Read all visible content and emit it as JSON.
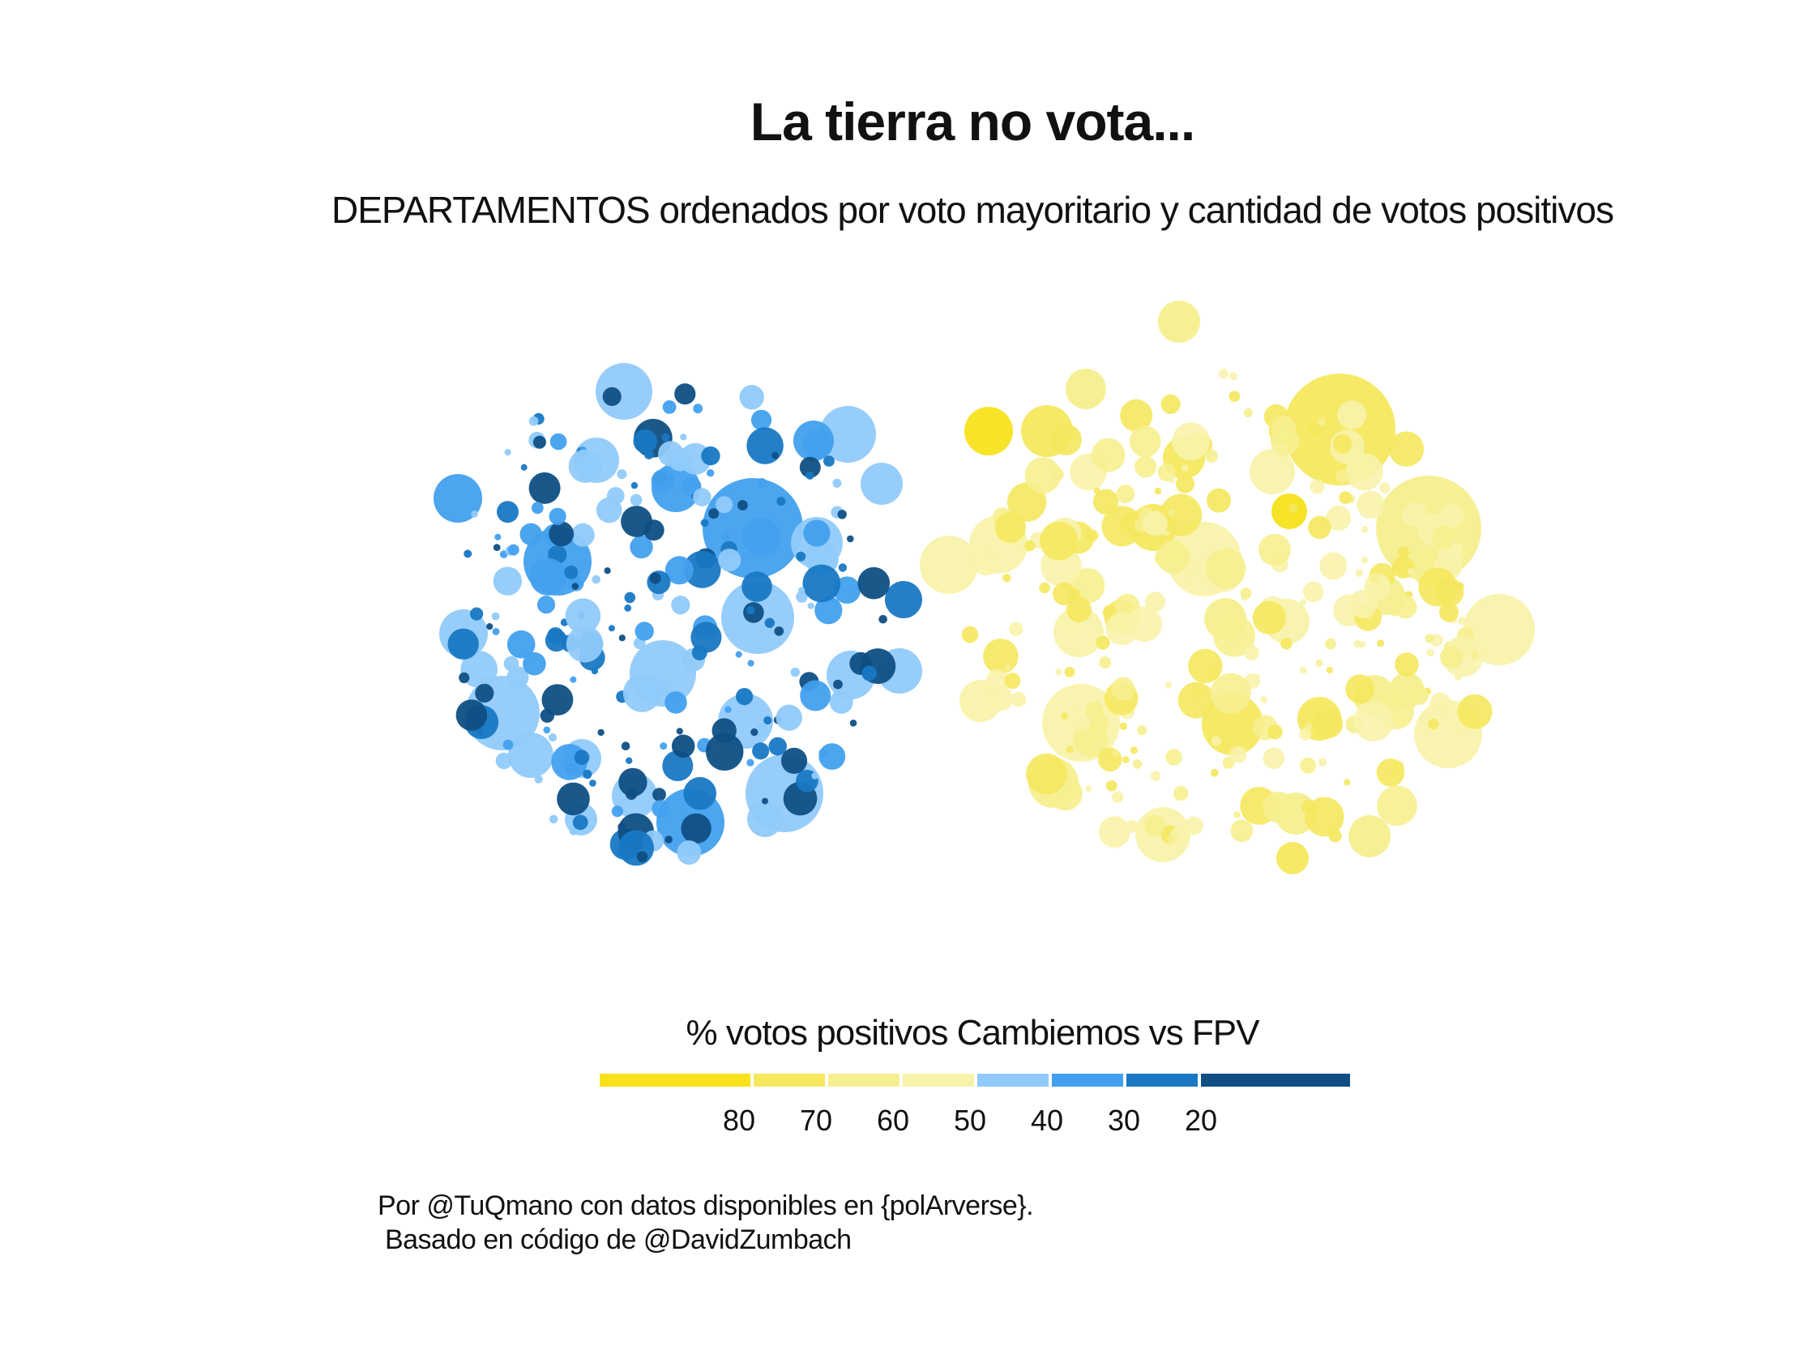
{
  "chart_data": {
    "type": "scatter",
    "subtype": "packed-bubble",
    "title": "La tierra no vota...",
    "subtitle": "DEPARTAMENTOS ordenados por voto mayoritario y cantidad de votos positivos",
    "groups": [
      "FPV",
      "Cambiemos"
    ],
    "size_encoding": "votos positivos",
    "color_encoding": "% votos positivos Cambiemos vs FPV",
    "legend": {
      "title": "% votos positivos Cambiemos vs FPV",
      "position": "bottom",
      "ticks": [
        "80",
        "70",
        "60",
        "50",
        "40",
        "30",
        "20"
      ],
      "bins": [
        {
          "color": "#f7e21c"
        },
        {
          "color": "#f5e85e"
        },
        {
          "color": "#f6ef8f"
        },
        {
          "color": "#f8f3ab"
        },
        {
          "color": "#90cafa"
        },
        {
          "color": "#42a0ee"
        },
        {
          "color": "#1878c4"
        },
        {
          "color": "#0f4f84"
        }
      ]
    },
    "caption_lines": [
      "Por @TuQmano con datos disponibles en {polArverse}.",
      " Basado en código de @DavidZumbach"
    ],
    "grid": false
  }
}
